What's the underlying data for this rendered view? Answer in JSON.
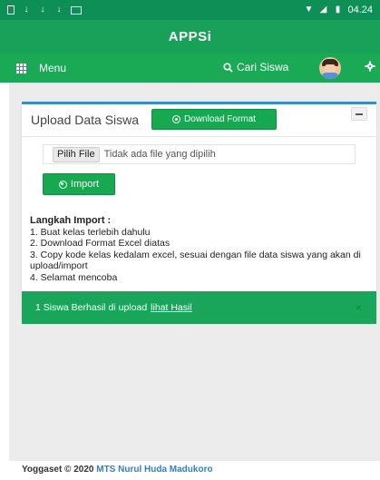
{
  "status_bar": {
    "time": "04.24"
  },
  "app": {
    "title": "APPSi"
  },
  "nav": {
    "menu_label": "Menu",
    "search_label": "Cari Siswa"
  },
  "panel": {
    "title": "Upload Data Siswa",
    "download_button": "Download Format",
    "file_button": "Pilih File",
    "file_status": "Tidak ada file yang dipilih",
    "import_button": "Import",
    "steps_title": "Langkah Import :",
    "steps": [
      "1. Buat kelas terlebih dahulu",
      "2. Download Format Excel diatas",
      "3. Copy kode kelas kedalam excel, sesuai dengan file data siswa yang akan di upload/import",
      "4. Selamat mencoba"
    ]
  },
  "alert": {
    "message": "1 Siswa Berhasil di upload",
    "link": "lihat Hasil",
    "close": "×"
  },
  "footer": {
    "prefix": "Yoggaset © 2020",
    "brand": "MTS Nurul Huda Madukoro"
  },
  "colors": {
    "header_green": "#19a15a",
    "button_green": "#16a94f",
    "panel_border": "#3c8dbc",
    "link_blue": "#2e7fd1"
  }
}
